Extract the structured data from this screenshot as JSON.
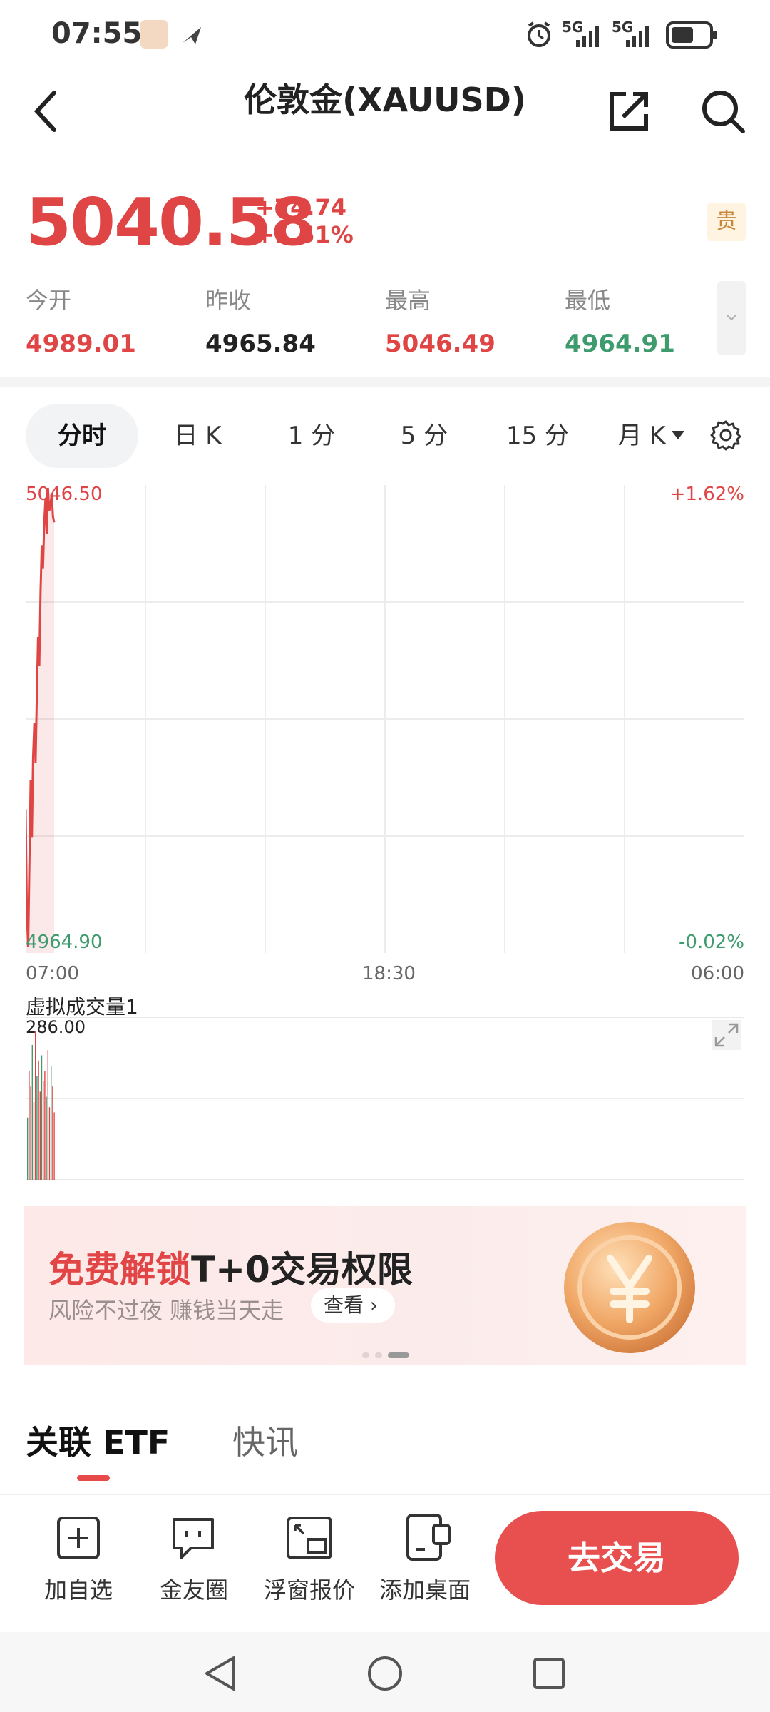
{
  "status": {
    "time": "07:55",
    "net1": "5G",
    "net2": "5G"
  },
  "nav": {
    "title": "伦敦金(XAUUSD)"
  },
  "quote": {
    "price": "5040.58",
    "change": "+74.74",
    "change_pct": "+1.51%",
    "tag": "贵",
    "stats": [
      {
        "label": "今开",
        "value": "4989.01",
        "color": "#e04545"
      },
      {
        "label": "昨收",
        "value": "4965.84",
        "color": "#222222"
      },
      {
        "label": "最高",
        "value": "5046.49",
        "color": "#e04545"
      },
      {
        "label": "最低",
        "value": "4964.91",
        "color": "#3e9b6e"
      }
    ]
  },
  "tabs": [
    "分时",
    "日 K",
    "1 分",
    "5 分",
    "15 分",
    "月 K"
  ],
  "chart_data": {
    "type": "line",
    "y_top_label": "5046.50",
    "y_bottom_label": "4964.90",
    "pct_top_label": "+1.62%",
    "pct_bottom_label": "-0.02%",
    "ylim": [
      4964.9,
      5046.5
    ],
    "x_tick_labels": [
      "07:00",
      "18:30",
      "06:00"
    ],
    "series": [
      {
        "values": [
          4990,
          4972,
          4966,
          4980,
          4995,
          4985,
          4999,
          5005,
          4998,
          5010,
          5020,
          5015,
          5028,
          5036,
          5032,
          5040,
          5044,
          5038,
          5046,
          5042,
          5043,
          5045,
          5041,
          5040
        ]
      }
    ],
    "volume_title": "虚拟成交量1",
    "volume_max_label": "286.00",
    "volume_values": [
      120,
      210,
      180,
      260,
      150,
      286,
      200,
      230,
      170,
      240,
      190,
      210,
      160,
      250,
      140,
      220,
      180,
      130
    ]
  },
  "banner": {
    "title_red": "免费解锁",
    "title_black": "T+0交易权限",
    "subtitle": "风险不过夜 赚钱当天走",
    "link": "查看"
  },
  "section_tabs": [
    "关联 ETF",
    "快讯"
  ],
  "bottom_bar": {
    "items": [
      "加自选",
      "金友圈",
      "浮窗报价",
      "添加桌面"
    ],
    "trade": "去交易"
  },
  "colors": {
    "up": "#e04545",
    "down": "#3e9b6e",
    "accent": "#e85050"
  }
}
